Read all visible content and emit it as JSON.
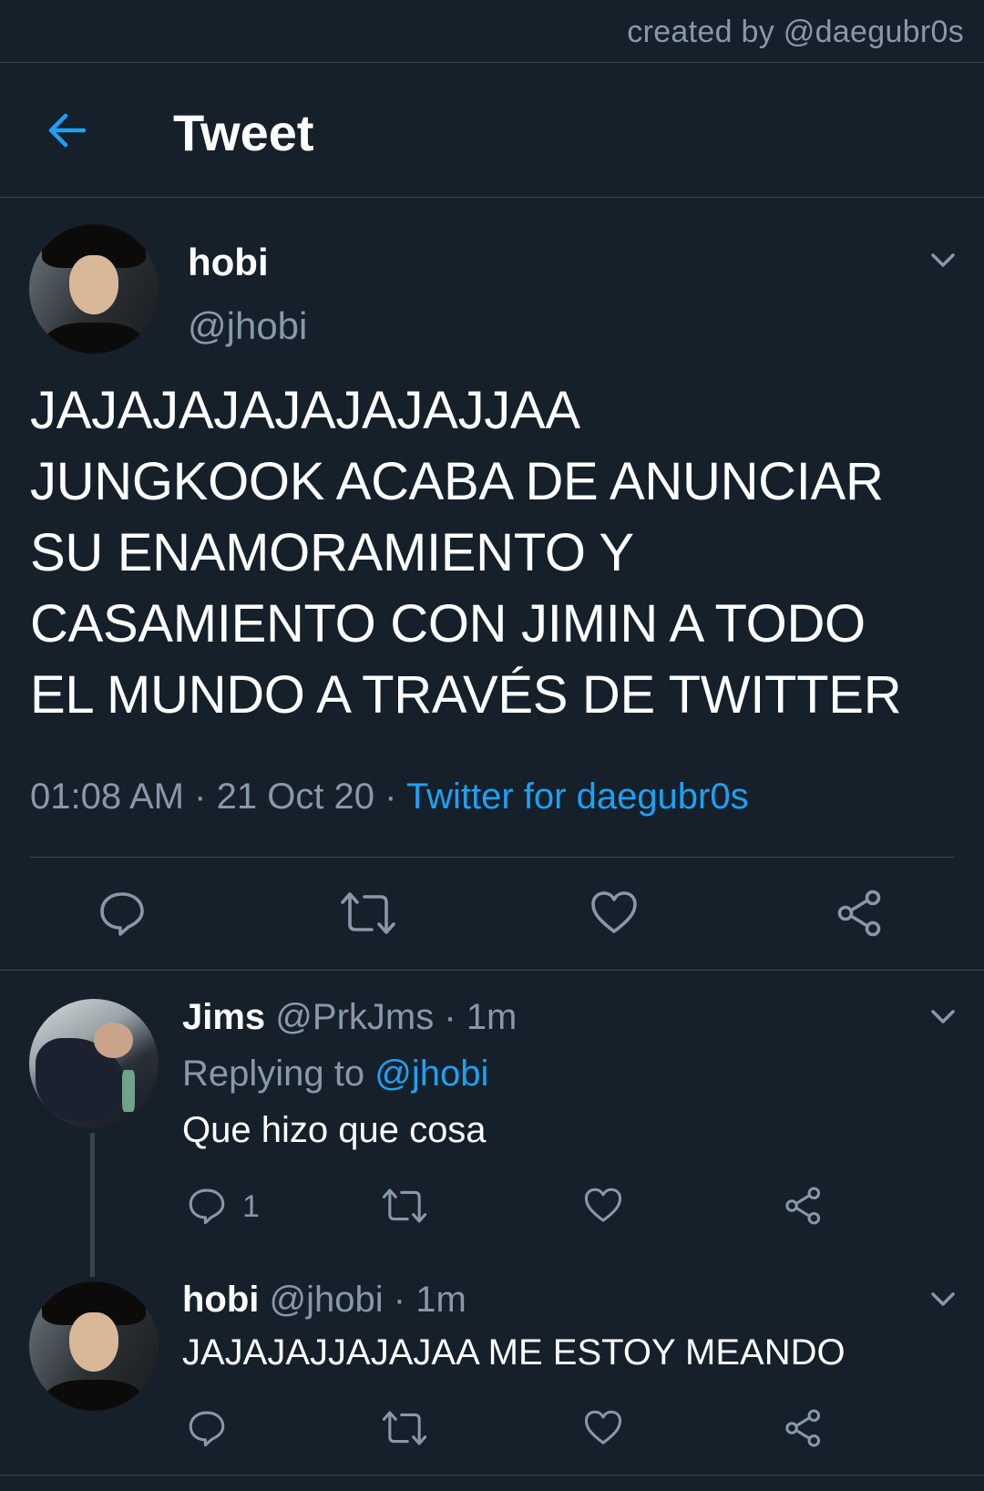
{
  "credit": "created by @daegubr0s",
  "header": {
    "title": "Tweet"
  },
  "main_tweet": {
    "name": "hobi",
    "handle": "@jhobi",
    "lines": [
      "JAJAJAJAJAJAJAJJAA",
      "JUNGKOOK ACABA DE ANUNCIAR",
      "SU ENAMORAMIENTO Y",
      "CASAMIENTO CON JIMIN A TODO",
      "EL MUNDO A TRAVÉS DE TWITTER"
    ],
    "time": "01:08 AM",
    "date": "21 Oct 20",
    "separator": "·",
    "source": "Twitter for daegubr0s"
  },
  "replies": [
    {
      "name": "Jims",
      "handle": "@PrkJms",
      "time": "1m",
      "replying_prefix": "Replying to",
      "replying_to": "@jhobi",
      "text": "Que hizo que cosa",
      "reply_count": "1"
    },
    {
      "name": "hobi",
      "handle": "@jhobi",
      "time": "1m",
      "text": "JAJAJAJJAJAJAA ME ESTOY MEANDO"
    }
  ],
  "icons": {
    "back": "arrow-left-icon",
    "more": "chevron-down-icon",
    "reply": "reply-bubble-icon",
    "retweet": "retweet-icon",
    "like": "heart-icon",
    "share": "share-icon"
  },
  "colors": {
    "background": "#15202b",
    "accent": "#1da1f2",
    "secondary_text": "#8899a6",
    "divider": "#38444d"
  }
}
